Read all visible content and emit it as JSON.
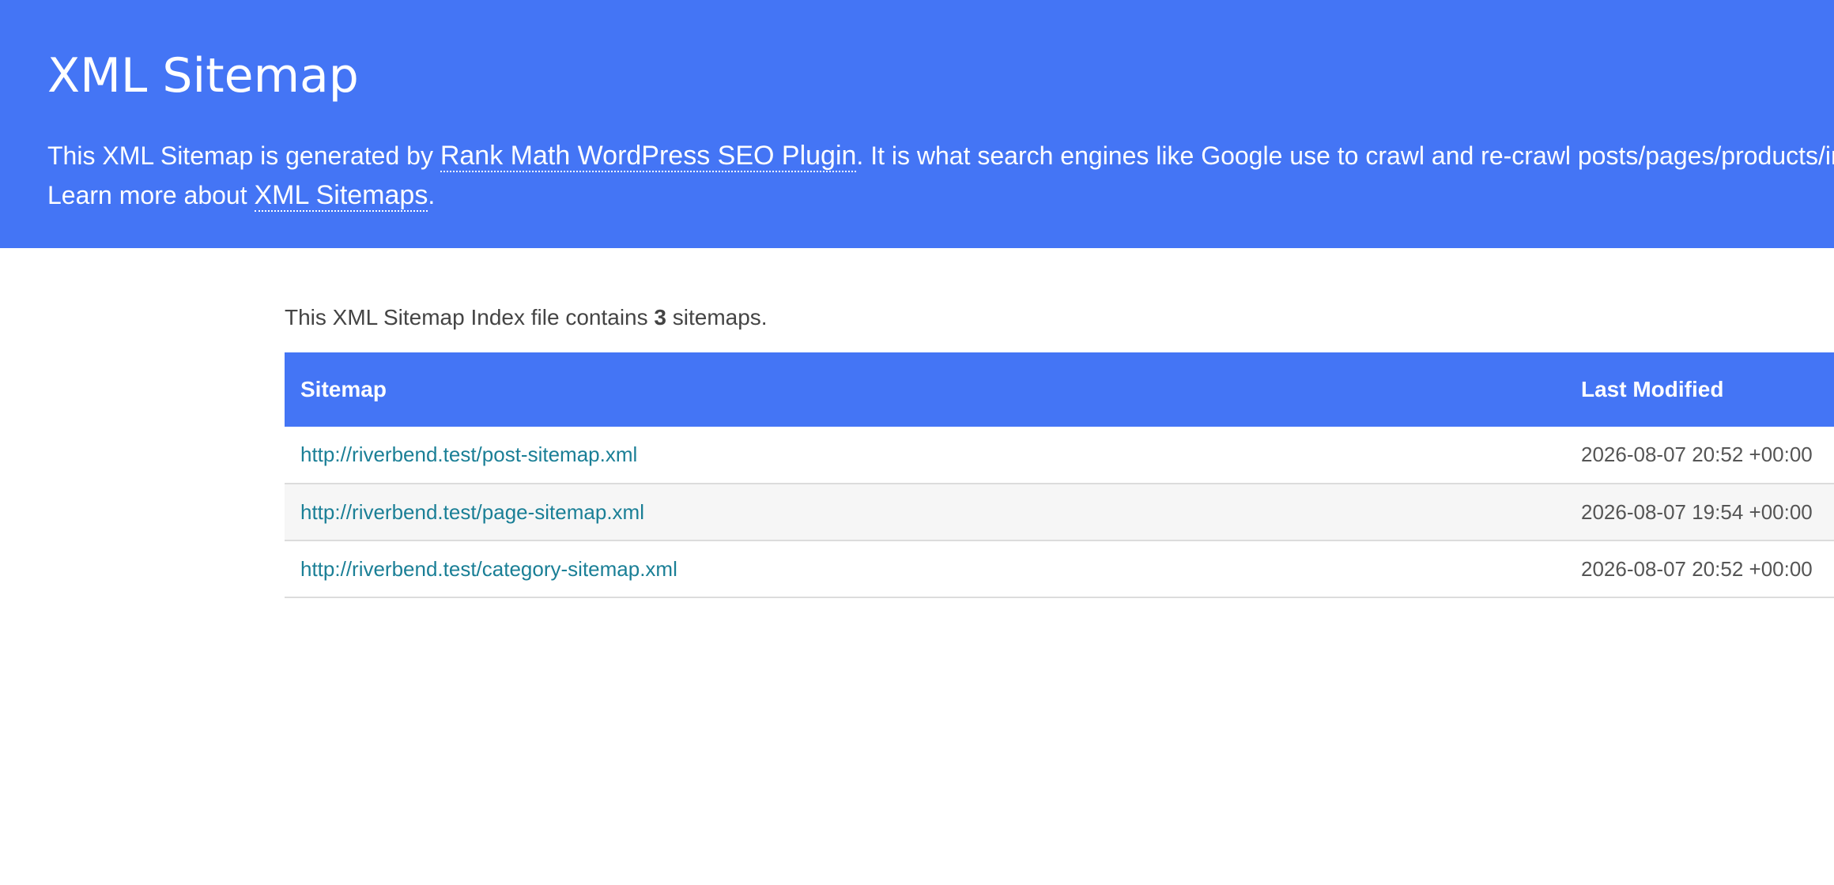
{
  "header": {
    "title": "XML Sitemap",
    "line1_prefix": "This XML Sitemap is generated by ",
    "plugin_link": "Rank Math WordPress SEO Plugin",
    "line1_suffix": ". It is what search engines like Google use to crawl and re-crawl posts/pages/products/ima",
    "line2_prefix": "Learn more about ",
    "sitemaps_link": "XML Sitemaps",
    "line2_suffix": "."
  },
  "summary": {
    "prefix": "This XML Sitemap Index file contains ",
    "count": "3",
    "suffix": " sitemaps."
  },
  "table": {
    "columns": [
      "Sitemap",
      "Last Modified"
    ],
    "rows": [
      {
        "url": "http://riverbend.test/post-sitemap.xml",
        "modified": "2026-08-07 20:52 +00:00"
      },
      {
        "url": "http://riverbend.test/page-sitemap.xml",
        "modified": "2026-08-07 19:54 +00:00"
      },
      {
        "url": "http://riverbend.test/category-sitemap.xml",
        "modified": "2026-08-07 20:52 +00:00"
      }
    ]
  },
  "colors": {
    "header_bg": "#4475f5",
    "link": "#1a7f96",
    "alt_row": "#f6f6f6"
  }
}
